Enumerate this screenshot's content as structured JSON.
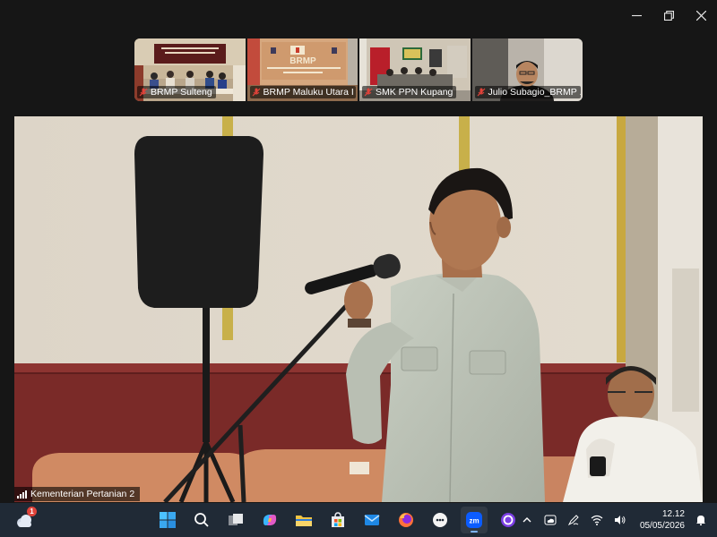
{
  "window": {
    "controls": [
      "minimize-icon",
      "restore-icon",
      "close-icon"
    ]
  },
  "gallery": {
    "participants": [
      {
        "name": "BRMP Sulteng",
        "mic": "muted"
      },
      {
        "name": "BRMP Maluku Utara I",
        "mic": "muted"
      },
      {
        "name": "SMK PPN Kupang",
        "mic": "muted"
      },
      {
        "name": "Julio Subagio_BRMP ...",
        "mic": "muted"
      }
    ]
  },
  "speaker": {
    "name": "Kementerian Pertanian 2"
  },
  "taskbar": {
    "weather_badge": "1",
    "apps": [
      "start-icon",
      "search-icon",
      "task-view-icon",
      "copilot-icon",
      "file-explorer-icon",
      "store-icon",
      "mail-icon",
      "firefox-icon",
      "chat-icon",
      "zoom-icon",
      "circle-app-icon"
    ],
    "active_app": "zoom-icon",
    "zoom_label": "zm",
    "time": "12.12",
    "date": "05/05/2026"
  },
  "colors": {
    "accent": "#7fb4ff",
    "taskbar": "#202a36",
    "window": "#161616",
    "muted_mic": "#e0433a"
  }
}
